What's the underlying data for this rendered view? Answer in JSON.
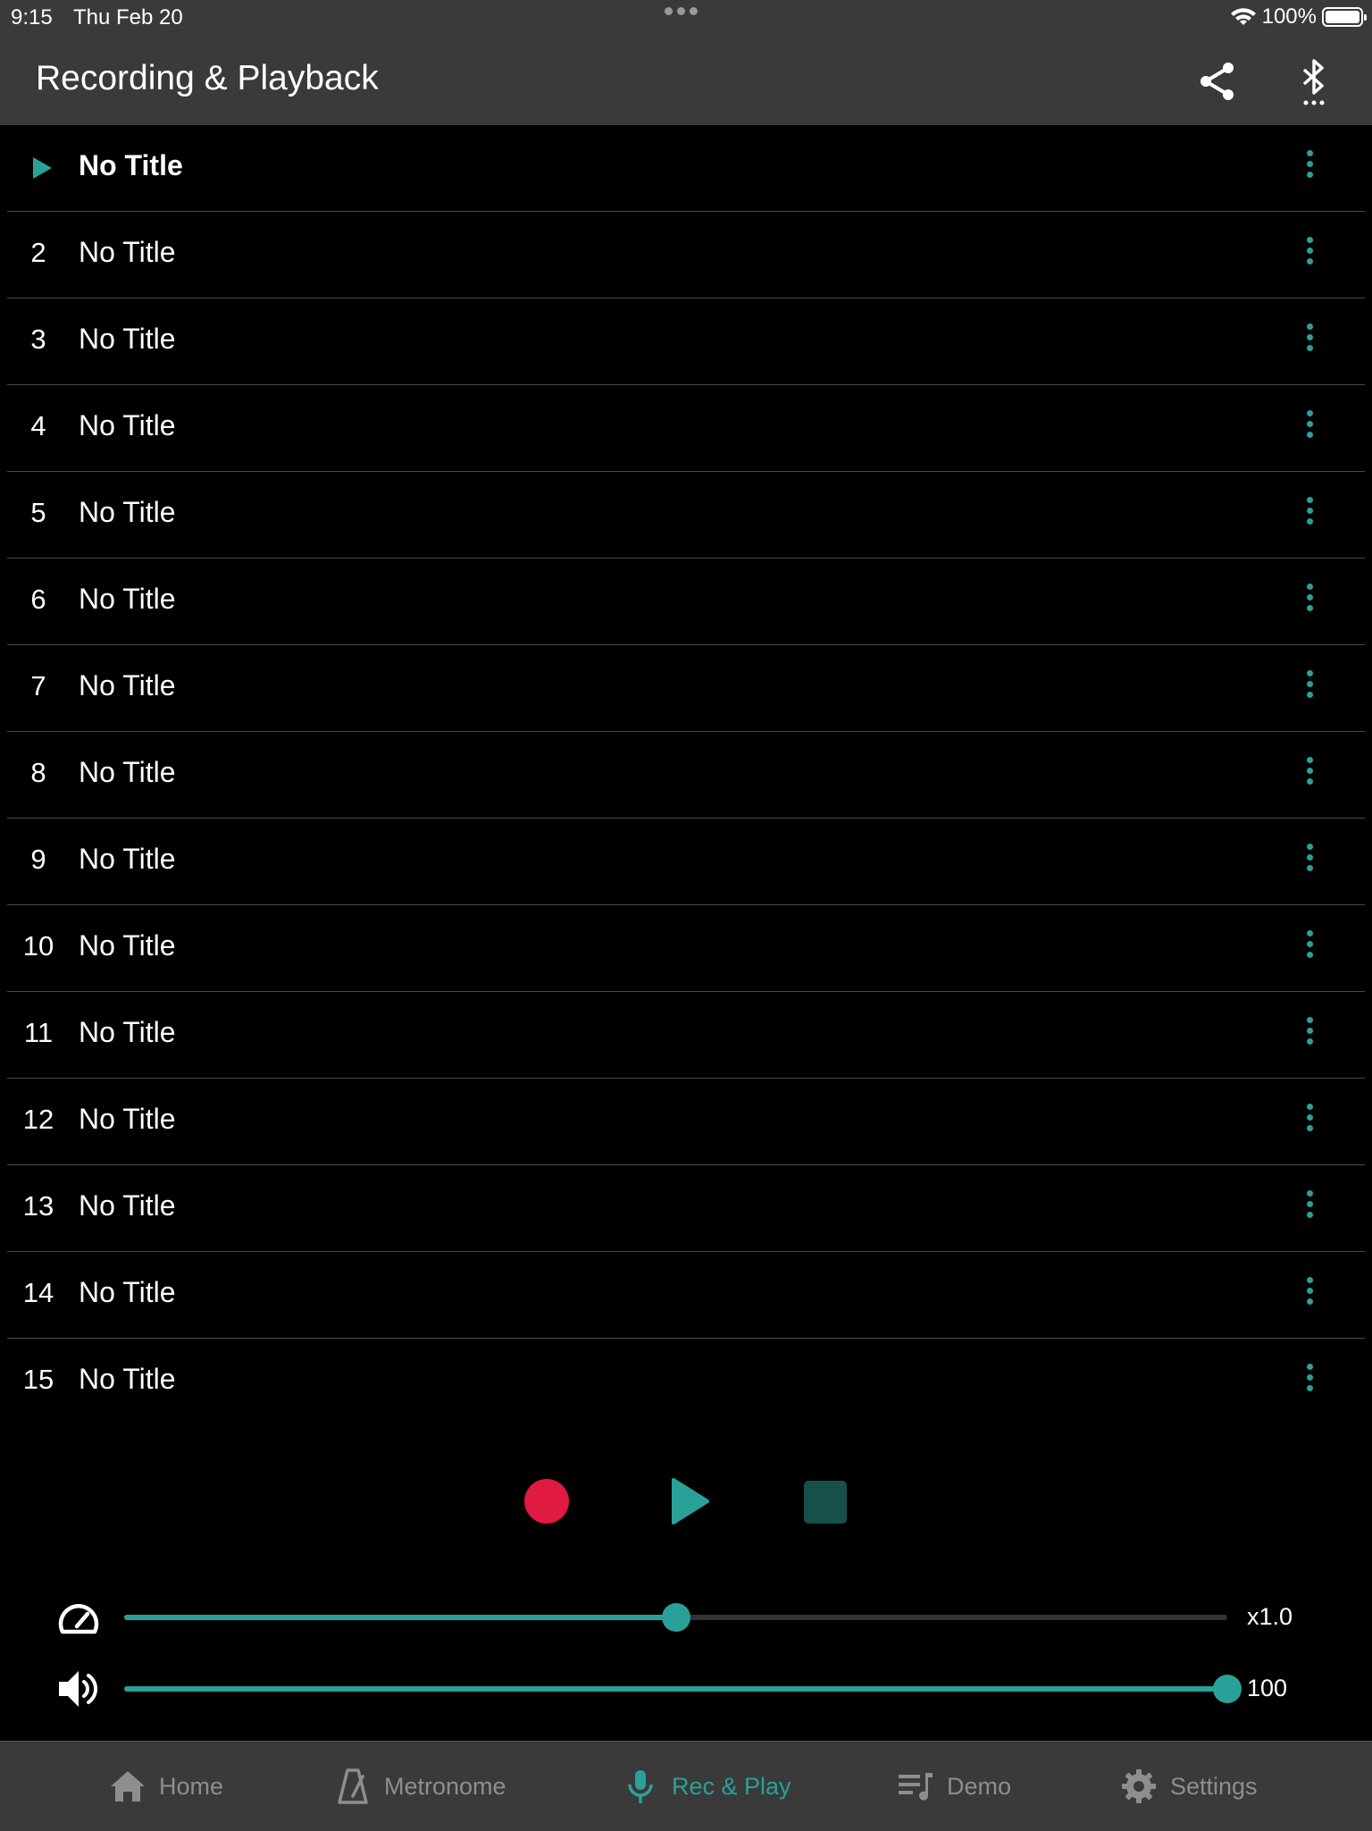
{
  "status_bar": {
    "time": "9:15",
    "date": "Thu Feb 20",
    "battery": "100%"
  },
  "header": {
    "title": "Recording & Playback"
  },
  "tracks": [
    {
      "num": "",
      "title": "No Title",
      "active": true
    },
    {
      "num": "2",
      "title": "No Title"
    },
    {
      "num": "3",
      "title": "No Title"
    },
    {
      "num": "4",
      "title": "No Title"
    },
    {
      "num": "5",
      "title": "No Title"
    },
    {
      "num": "6",
      "title": "No Title"
    },
    {
      "num": "7",
      "title": "No Title"
    },
    {
      "num": "8",
      "title": "No Title"
    },
    {
      "num": "9",
      "title": "No Title"
    },
    {
      "num": "10",
      "title": "No Title"
    },
    {
      "num": "11",
      "title": "No Title"
    },
    {
      "num": "12",
      "title": "No Title"
    },
    {
      "num": "13",
      "title": "No Title"
    },
    {
      "num": "14",
      "title": "No Title"
    },
    {
      "num": "15",
      "title": "No Title"
    }
  ],
  "transport": {
    "record_icon": "record-icon",
    "play_icon": "play-icon",
    "stop_icon": "stop-icon"
  },
  "speed": {
    "value_label": "x1.0",
    "fraction": 0.5
  },
  "volume": {
    "value_label": "100",
    "fraction": 1.0
  },
  "tabs": [
    {
      "label": "Home",
      "icon": "home-icon"
    },
    {
      "label": "Metronome",
      "icon": "metronome-icon"
    },
    {
      "label": "Rec & Play",
      "icon": "microphone-icon",
      "active": true
    },
    {
      "label": "Demo",
      "icon": "playlist-icon"
    },
    {
      "label": "Settings",
      "icon": "gear-icon"
    }
  ],
  "colors": {
    "accent": "#2aa198",
    "record": "#e01a40",
    "stop": "#16504b",
    "bar": "#3a3a3a"
  }
}
